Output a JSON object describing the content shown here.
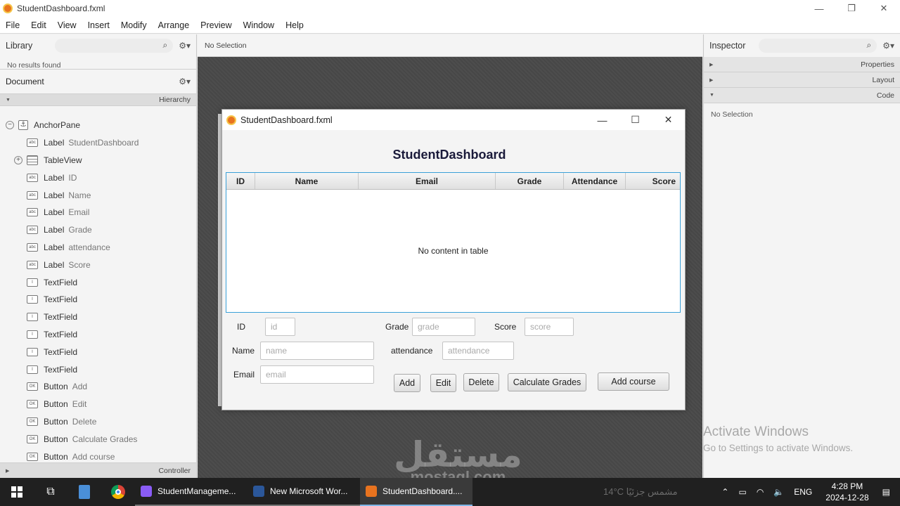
{
  "window": {
    "title": "StudentDashboard.fxml",
    "minimize": "—",
    "maximize": "❐",
    "close": "✕"
  },
  "menu": [
    "File",
    "Edit",
    "View",
    "Insert",
    "Modify",
    "Arrange",
    "Preview",
    "Window",
    "Help"
  ],
  "library": {
    "title": "Library",
    "no_results": "No results found"
  },
  "document": {
    "title": "Document",
    "hierarchy_label": "Hierarchy",
    "controller_label": "Controller",
    "tree": [
      {
        "kind": "AnchorPane",
        "value": "",
        "icon": "anchor-icon",
        "glyph": "⚓",
        "indent": 0,
        "expander": "−"
      },
      {
        "kind": "Label",
        "value": "StudentDashboard",
        "icon": "label-icon",
        "glyph": "abc",
        "indent": 1,
        "expander": ""
      },
      {
        "kind": "TableView",
        "value": "",
        "icon": "table-icon",
        "glyph": "",
        "indent": 1,
        "expander": "+"
      },
      {
        "kind": "Label",
        "value": "ID",
        "icon": "label-icon",
        "glyph": "abc",
        "indent": 1,
        "expander": ""
      },
      {
        "kind": "Label",
        "value": "Name",
        "icon": "label-icon",
        "glyph": "abc",
        "indent": 1,
        "expander": ""
      },
      {
        "kind": "Label",
        "value": "Email",
        "icon": "label-icon",
        "glyph": "abc",
        "indent": 1,
        "expander": ""
      },
      {
        "kind": "Label",
        "value": "Grade",
        "icon": "label-icon",
        "glyph": "abc",
        "indent": 1,
        "expander": ""
      },
      {
        "kind": "Label",
        "value": "attendance",
        "icon": "label-icon",
        "glyph": "abc",
        "indent": 1,
        "expander": ""
      },
      {
        "kind": "Label",
        "value": "Score",
        "icon": "label-icon",
        "glyph": "abc",
        "indent": 1,
        "expander": ""
      },
      {
        "kind": "TextField",
        "value": "",
        "icon": "textfield-icon",
        "glyph": "I",
        "indent": 1,
        "expander": ""
      },
      {
        "kind": "TextField",
        "value": "",
        "icon": "textfield-icon",
        "glyph": "I",
        "indent": 1,
        "expander": ""
      },
      {
        "kind": "TextField",
        "value": "",
        "icon": "textfield-icon",
        "glyph": "I",
        "indent": 1,
        "expander": ""
      },
      {
        "kind": "TextField",
        "value": "",
        "icon": "textfield-icon",
        "glyph": "I",
        "indent": 1,
        "expander": ""
      },
      {
        "kind": "TextField",
        "value": "",
        "icon": "textfield-icon",
        "glyph": "I",
        "indent": 1,
        "expander": ""
      },
      {
        "kind": "TextField",
        "value": "",
        "icon": "textfield-icon",
        "glyph": "I",
        "indent": 1,
        "expander": ""
      },
      {
        "kind": "Button",
        "value": "Add",
        "icon": "button-icon",
        "glyph": "OK",
        "indent": 1,
        "expander": ""
      },
      {
        "kind": "Button",
        "value": "Edit",
        "icon": "button-icon",
        "glyph": "OK",
        "indent": 1,
        "expander": ""
      },
      {
        "kind": "Button",
        "value": "Delete",
        "icon": "button-icon",
        "glyph": "OK",
        "indent": 1,
        "expander": ""
      },
      {
        "kind": "Button",
        "value": "Calculate Grades",
        "icon": "button-icon",
        "glyph": "OK",
        "indent": 1,
        "expander": ""
      },
      {
        "kind": "Button",
        "value": "Add course",
        "icon": "button-icon",
        "glyph": "OK",
        "indent": 1,
        "expander": ""
      }
    ]
  },
  "center": {
    "selection": "No Selection"
  },
  "preview": {
    "title": "StudentDashboard.fxml",
    "heading": "StudentDashboard",
    "table": {
      "columns": [
        "ID",
        "Name",
        "Email",
        "Grade",
        "Attendance",
        "Score"
      ],
      "empty_text": "No content in table"
    },
    "fields": {
      "id_label": "ID",
      "id_placeholder": "id",
      "name_label": "Name",
      "name_placeholder": "name",
      "email_label": "Email",
      "email_placeholder": "email",
      "grade_label": "Grade",
      "grade_placeholder": "grade",
      "attendance_label": "attendance",
      "attendance_placeholder": "attendance",
      "score_label": "Score",
      "score_placeholder": "score"
    },
    "buttons": {
      "add": "Add",
      "edit": "Edit",
      "delete": "Delete",
      "calculate": "Calculate Grades",
      "add_course": "Add course"
    }
  },
  "inspector": {
    "title": "Inspector",
    "sections": [
      "Properties",
      "Layout",
      "Code"
    ],
    "selection": "No Selection"
  },
  "activation": {
    "line1": "Activate Windows",
    "line2": "Go to Settings to activate Windows."
  },
  "watermark": {
    "arabic": "مستقل",
    "latin": "mostaql.com"
  },
  "taskbar": {
    "apps": [
      {
        "label": "StudentManageme...",
        "color": "#8a5cf6"
      },
      {
        "label": "New Microsoft Wor...",
        "color": "#2b579a"
      },
      {
        "label": "StudentDashboard....",
        "color": "#e8731f"
      }
    ],
    "weather": "14°C  مشمس جزئيًا",
    "language": "ENG",
    "time": "4:28 PM",
    "date": "2024-12-28"
  }
}
